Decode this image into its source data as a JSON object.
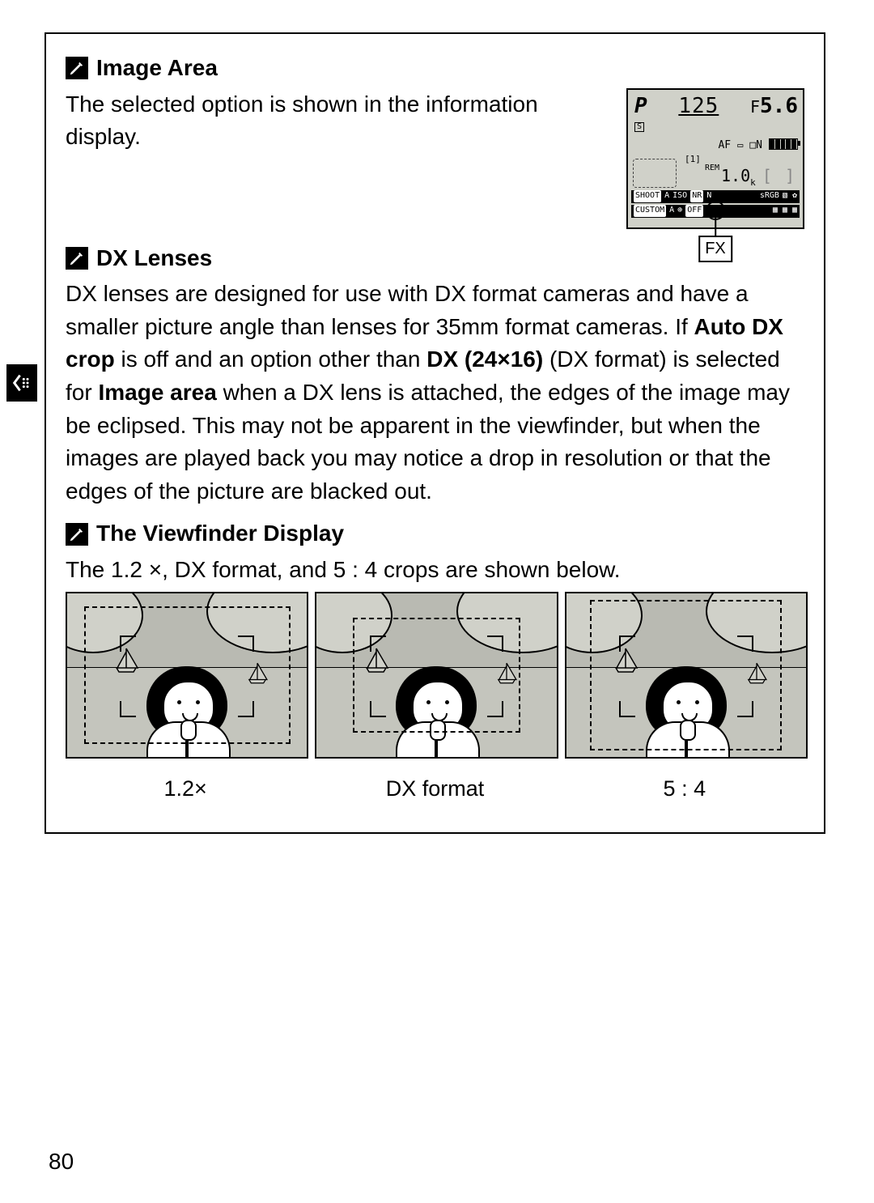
{
  "page_number": "80",
  "sections": {
    "image_area": {
      "heading": "Image Area",
      "text": "The selected option is shown in the information display."
    },
    "dx_lenses": {
      "heading": "DX Lenses",
      "text_pre": "DX lenses are designed for use with DX format cameras and have a smaller picture angle than lenses for 35mm format cameras.  If ",
      "bold_auto_dx_crop": "Auto DX crop",
      "text_mid1": " is off and an option other than ",
      "bold_dx_24x16": "DX (24×16)",
      "text_mid2": " (DX format) is selected for ",
      "bold_image_area": "Image area",
      "text_post": " when a DX lens is attached, the edges of the image may be eclipsed.  This may not be apparent in the viewfinder, but when the images are played back you may notice a drop in resolution or that the edges of the picture are blacked out."
    },
    "viewfinder": {
      "heading": "The Viewfinder Display",
      "text": "The 1.2 ×, DX format, and 5 : 4 crops are shown below.",
      "labels": {
        "a": "1.2×",
        "b": "DX format",
        "c": "5 : 4"
      }
    }
  },
  "lcd": {
    "mode": "P",
    "shutter": "125",
    "aperture_prefix": "F",
    "aperture": "5.6",
    "slot": "S",
    "af": "AF",
    "n_indicator": "N",
    "card": "1",
    "rem": "REM",
    "count": "1.0",
    "count_suffix": "k",
    "bracket": "[       ]",
    "bar1_shoot": "SHOOT",
    "bar1_bank": "A",
    "bar1_iso": "ISO",
    "bar1_nr": "NR",
    "bar1_n": "N",
    "bar1_srgb": "sRGB",
    "bar2_custom": "CUSTOM",
    "bar2_bank": "A",
    "bar2_off": "OFF",
    "callout": "FX"
  }
}
